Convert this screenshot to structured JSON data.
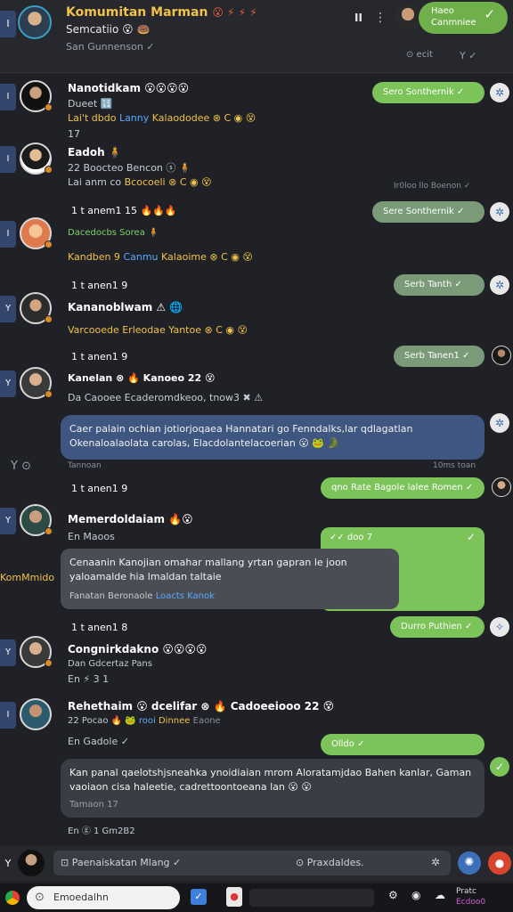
{
  "header": {
    "back": "I",
    "title": "Komumitan Marman",
    "title_emoji": "😮 ⚡ ⚡ ⚡",
    "subtitle": "Semcatiio 😮 🍩",
    "status": "San Gunnenson ✓",
    "pause": "II",
    "more": "⋮",
    "pill_line1": "Haeo",
    "pill_line2": "Canmniee",
    "pill_check": "✓",
    "tools": "⊙ ecit",
    "tools2": "Y  ✓"
  },
  "rows": [
    {
      "back": "I",
      "name": "Nanotidkam 😮😮😮😮",
      "line1": "Dueet 🔢",
      "line2a": "Lai't dbdo",
      "line2b": "Lanny",
      "line2c": "Kalaododee ⊗ C ◉ 😵",
      "line3": "17",
      "right_pill": "Sero Sonthernik ✓",
      "right_icon": "✲"
    },
    {
      "back": "I",
      "name": "Eadoh 🧍",
      "line1": "22 Boocteo Bencon ⓢ 🧍",
      "line2a": "Lai anm co",
      "line2b": "Bcocoeli",
      "line2c": "⊗ C ◉ 😵",
      "right_meta": "Ir0loo llo Boenon ✓"
    },
    {
      "name": "1 t anem1 15 🔥🔥🔥",
      "line1": "Dacedocbs Sorea 🧍",
      "line2a": "Kandben 9",
      "line2b": "Canmu",
      "line2c": "Kalaoime ⊗ C ◉ 😵",
      "right_pill": "Sere Sonthernik ✓",
      "right_icon": "✲"
    },
    {
      "name": "1 t anen1 9",
      "line1": "Kananoblwam ⚠ 🌐",
      "line2a": "Varcooede",
      "line2b": "Erleodae",
      "line2c": "Yantoe ⊗ C ◉ 😵",
      "right_pill": "Serb Tanth ✓",
      "right_icon": "✲"
    },
    {
      "name": "1 t anen1 9",
      "line1": "Kanelan ⊗ 🔥 Kanoeo 22 😵",
      "line2": "Da Caooee Ecaderomdkeoo, tnow3 ✖ ⚠",
      "right_pill": "Serb Tanen1 ✓"
    }
  ],
  "blue_bubble": {
    "text": "Caer palain ochian jotiorjoqaea Hannatari go Fenndalks,lar qdlagatlan Okenaloalaolata carolas, Elacdolantelacoerian 😮 🐸 🐊",
    "meta_left": "Tannoan",
    "meta_right": "10ms toan"
  },
  "side": {
    "icons": "Y  ⊙",
    "label": "KomMmido"
  },
  "row6": {
    "name": "1 t anen1 9",
    "right_pill": "qno Rate Bagole lalee Romen ✓",
    "title": "Memerdoldaiam 🔥😮",
    "sub": "En Maoos",
    "green_top": "✓✓ doo  7"
  },
  "gray_bubble": {
    "text": "Cenaanin Kanojian omahar mallang yrtan gapran le joon yaloamalde hia lmaldan taltaie",
    "footer_a": "Fanatan Beronaole",
    "footer_b": "Loacts Kanok"
  },
  "row7": {
    "name": "1 t anen1 8",
    "right_pill": "Durro Puthien ✓",
    "title": "Congnirkdakno 😮😮😮😮",
    "sub1": "Dan Gdcertaz Pans",
    "sub2": "En ⚡ 3 1"
  },
  "row8": {
    "name": "Rehethaim 😮 dcelifar ⊗ 🔥 Cadoeeiooo 22 😵",
    "line1a": "22 Pocao 🔥 🐸",
    "line1b": "rooi",
    "line1c": "Dinnee",
    "line1d": "Eaone",
    "line2": "En Gadole ✓",
    "right_pill": "Olldo ✓"
  },
  "dark_bubble": {
    "text": "Kan panal qaelotshjsneahka ynoidiaian mrom Aloratamjdao Bahen kanlar, Gaman vaoiaon cisa haleetie, cadrettoontoeana lan 😮 😮",
    "footer": "Tamaon 17",
    "below": "En ⓖ 1 Gm2B2"
  },
  "composer": {
    "back": "Y",
    "placeholder": "⊡ Paenaiskatan Mlang ✓",
    "emoji": "⊙ Praxdaldes.",
    "attach": "✲",
    "send": "✺",
    "record": "●"
  },
  "taskbar": {
    "search": "Emoedalhn",
    "clock1": "Pratc",
    "clock2": "Ecdoo0"
  }
}
